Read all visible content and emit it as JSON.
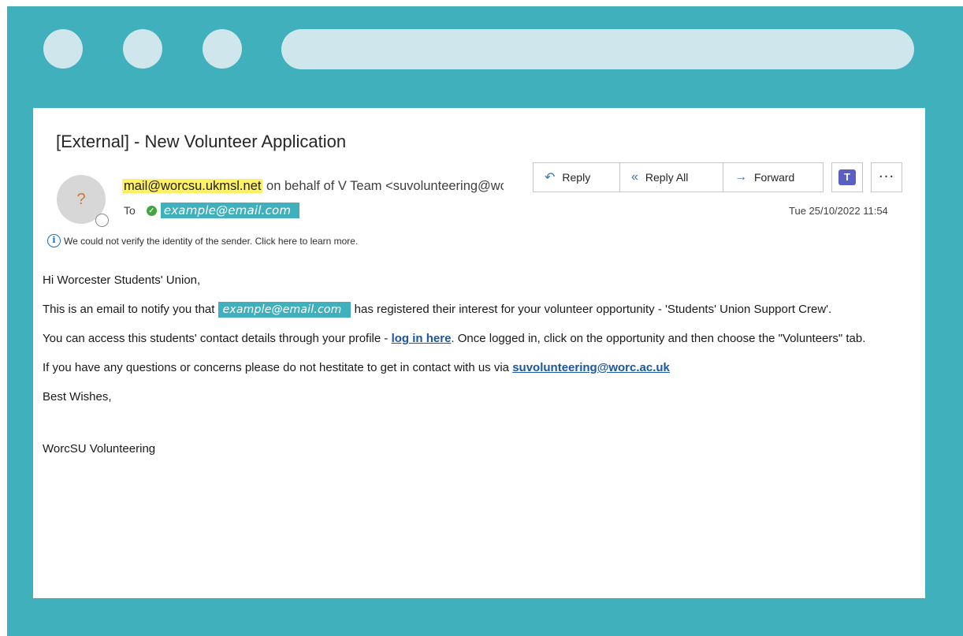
{
  "email": {
    "subject": "[External]  - New Volunteer Application",
    "avatar_initial": "?",
    "from_address": "mail@worcsu.ukmsl.net",
    "from_rest": " on behalf of V Team <suvolunteering@worc.ac.uk>",
    "to_label": "To",
    "to_address": "example@email.com",
    "warning": "We could not verify the identity of the sender. Click here to learn more.",
    "date": "Tue 25/10/2022 11:54",
    "actions": {
      "reply": "Reply",
      "reply_all": "Reply All",
      "forward": "Forward",
      "teams": "T",
      "more": "···"
    },
    "body": {
      "greeting": "Hi Worcester Students' Union,",
      "p1_before": "This is an email to notify you that ",
      "p1_email": "example@email.com",
      "p1_after": " has registered their interest for your volunteer opportunity - 'Students' Union Support Crew'.",
      "p2_before": "You can access this students' contact details through your profile - ",
      "p2_link": "log in here",
      "p2_after": ". Once logged in, click on the opportunity and then choose the \"Volunteers\" tab.",
      "p3_before": "If you have any questions or concerns please do not hestitate to get in contact with us via ",
      "p3_link": "suvolunteering@worc.ac.uk",
      "wishes": "Best Wishes,",
      "signature": "WorcSU Volunteering"
    }
  },
  "colors": {
    "frame": "#41b0bd",
    "frame_accent": "#cfe6ec",
    "highlight": "#fff15f",
    "link": "#1a56a4"
  }
}
